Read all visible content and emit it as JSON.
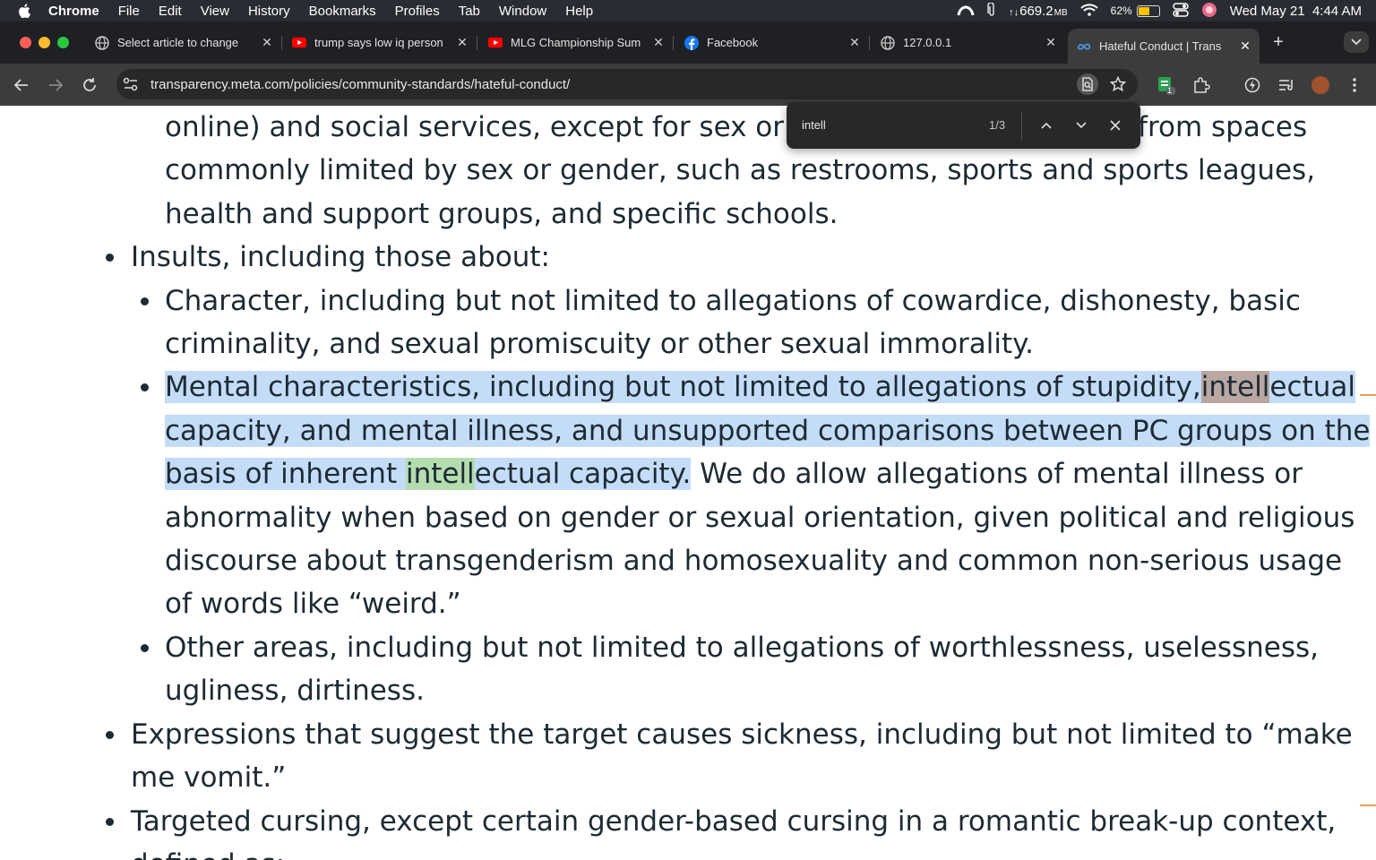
{
  "menubar": {
    "app_name": "Chrome",
    "menus": [
      "File",
      "Edit",
      "View",
      "History",
      "Bookmarks",
      "Profiles",
      "Tab",
      "Window",
      "Help"
    ],
    "memory": "669.2",
    "memory_unit": "MB",
    "battery_percent": "62%",
    "battery_level": 0.62,
    "datetime": "Wed May 21  4:44 AM"
  },
  "tabs": [
    {
      "title": "Select article to change",
      "icon": "globe-icon"
    },
    {
      "title": "trump says low iq person",
      "icon": "youtube-icon"
    },
    {
      "title": "MLG Championship Sum",
      "icon": "youtube-icon"
    },
    {
      "title": "Facebook",
      "icon": "facebook-icon"
    },
    {
      "title": "127.0.0.1",
      "icon": "globe-icon"
    },
    {
      "title": "Hateful Conduct | Trans",
      "icon": "meta-icon",
      "active": true
    }
  ],
  "toolbar": {
    "url": "transparency.meta.com/policies/community-standards/hateful-conduct/",
    "extension_badge": "1"
  },
  "findbar": {
    "query": "intell",
    "count": "1/3"
  },
  "content": {
    "para1": "online) and social services, except for sex or gender-based exclusions from spaces commonly limited by sex or gender, such as restrooms, sports and sports leagues, health and support groups, and specific schools.",
    "para1_line1_left": "online) and social services, except for sex or",
    "para1_line1_right": "from spaces",
    "para1_rest": "commonly limited by sex or gender, such as restrooms, sports and sports leagues, health and support groups, and specific schools.",
    "insults": "Insults, including those about:",
    "character": "Character, including but not limited to allegations of cowardice, dishonesty, basic criminality, and sexual promiscuity or other sexual immorality.",
    "mental_a": "Mental characteristics, including but not limited to allegations of stupidity,",
    "mental_match1": "intell",
    "mental_b": "ectual capacity, and mental illness, and unsupported comparisons between PC groups on the basis of inherent ",
    "mental_match2": "intell",
    "mental_c": "ectual capacity.",
    "mental_d": " We do allow allegations of mental illness or abnormality when based on gender or sexual orientation, given political and religious discourse about transgenderism and homosexuality and common non-serious usage of words like “weird.”",
    "other": "Other areas, including but not limited to allegations of worthlessness, uselessness, ugliness, dirtiness.",
    "expressions": "Expressions that suggest the target causes sickness, including but not limited to “make me vomit.”",
    "cursing": "Targeted cursing, except certain gender-based cursing in a romantic break-up context, defined as:"
  },
  "colors": {
    "selection": "#c5dcf8",
    "current_match": "#b9a7a2",
    "other_match": "#b4dcae",
    "text": "#1c2b33"
  }
}
